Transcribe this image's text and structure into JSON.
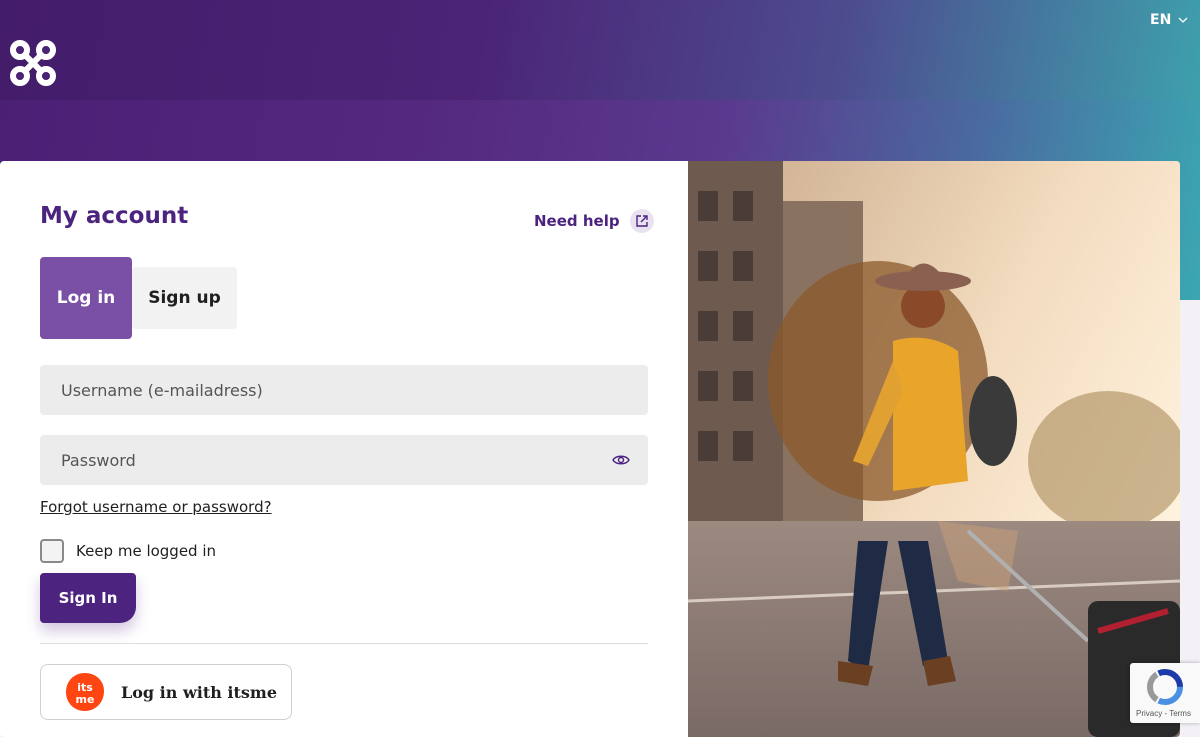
{
  "header": {
    "language": "EN",
    "logo_icon": "command-icon"
  },
  "account": {
    "title": "My account",
    "help_label": "Need help",
    "tabs": [
      {
        "label": "Log in",
        "active": true
      },
      {
        "label": "Sign up",
        "active": false
      }
    ]
  },
  "form": {
    "username_placeholder": "Username (e-mailadress)",
    "username_value": "",
    "password_placeholder": "Password",
    "password_value": "",
    "forgot_label": "Forgot username or password?",
    "keep_logged_in_label": "Keep me logged in",
    "keep_logged_in_checked": false,
    "signin_label": "Sign In",
    "itsme_label": "Log in with itsme",
    "itsme_logo_text": "itsme"
  },
  "recaptcha": {
    "links": "Privacy - Terms"
  },
  "colors": {
    "brand_purple": "#4c2480",
    "tab_active": "#7a4fa6",
    "itsme_red": "#ff4612",
    "hero_teal": "#3ba7b2"
  }
}
